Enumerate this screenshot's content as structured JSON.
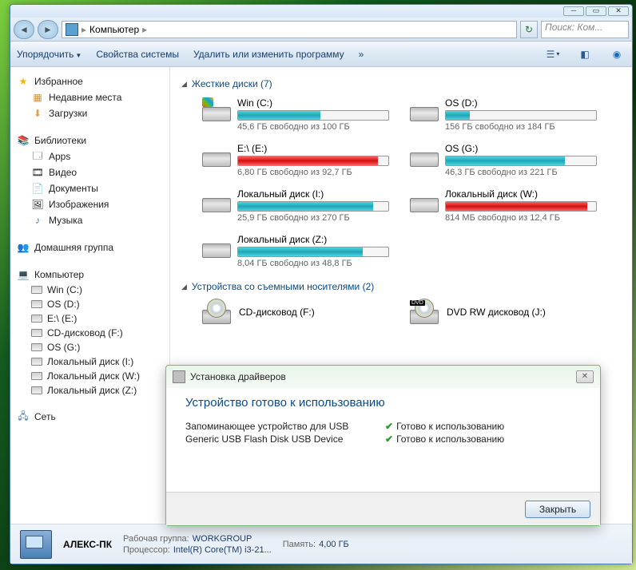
{
  "breadcrumb": {
    "root_icon": "computer",
    "location": "Компьютер",
    "sep": "▸"
  },
  "search": {
    "placeholder": "Поиск: Ком..."
  },
  "toolbar": {
    "organize": "Упорядочить",
    "sysprops": "Свойства системы",
    "uninstall": "Удалить или изменить программу",
    "more": "»"
  },
  "sidebar": {
    "favorites": {
      "label": "Избранное",
      "items": [
        "Недавние места",
        "Загрузки"
      ]
    },
    "libraries": {
      "label": "Библиотеки",
      "items": [
        "Apps",
        "Видео",
        "Документы",
        "Изображения",
        "Музыка"
      ]
    },
    "homegroup": {
      "label": "Домашняя группа"
    },
    "computer": {
      "label": "Компьютер",
      "items": [
        "Win (C:)",
        "OS (D:)",
        "E:\\ (E:)",
        "CD-дисковод (F:)",
        "OS (G:)",
        "Локальный диск (I:)",
        "Локальный диск (W:)",
        "Локальный диск (Z:)"
      ]
    },
    "network": {
      "label": "Сеть"
    }
  },
  "sections": {
    "hdd": {
      "title": "Жесткие диски (7)"
    },
    "removable": {
      "title": "Устройства со съемными носителями (2)"
    }
  },
  "drives": [
    {
      "name": "Win (C:)",
      "free": "45,6 ГБ свободно из 100 ГБ",
      "pct": 55,
      "color": "teal",
      "flag": "win"
    },
    {
      "name": "OS (D:)",
      "free": "156 ГБ свободно из 184 ГБ",
      "pct": 16,
      "color": "teal"
    },
    {
      "name": "E:\\ (E:)",
      "free": "6,80 ГБ свободно из 92,7 ГБ",
      "pct": 93,
      "color": "red"
    },
    {
      "name": "OS (G:)",
      "free": "46,3 ГБ свободно из 221 ГБ",
      "pct": 79,
      "color": "teal"
    },
    {
      "name": "Локальный диск (I:)",
      "free": "25,9 ГБ свободно из 270 ГБ",
      "pct": 90,
      "color": "teal"
    },
    {
      "name": "Локальный диск (W:)",
      "free": "814 МБ свободно из 12,4 ГБ",
      "pct": 94,
      "color": "red"
    },
    {
      "name": "Локальный диск (Z:)",
      "free": "8,04 ГБ свободно из 48,8 ГБ",
      "pct": 83,
      "color": "teal"
    }
  ],
  "removables": [
    {
      "name": "CD-дисковод (F:)",
      "type": "cd"
    },
    {
      "name": "DVD RW дисковод (J:)",
      "type": "dvd"
    }
  ],
  "details": {
    "name": "АЛЕКС-ПК",
    "workgroup_lbl": "Рабочая группа:",
    "workgroup": "WORKGROUP",
    "cpu_lbl": "Процессор:",
    "cpu": "Intel(R) Core(TM) i3-21...",
    "mem_lbl": "Память:",
    "mem": "4,00 ГБ"
  },
  "popup": {
    "title": "Установка драйверов",
    "heading": "Устройство готово к использованию",
    "rows": [
      {
        "dev": "Запоминающее устройство для USB",
        "status": "Готово к использованию"
      },
      {
        "dev": "Generic USB Flash Disk USB Device",
        "status": "Готово к использованию"
      }
    ],
    "close": "Закрыть"
  }
}
